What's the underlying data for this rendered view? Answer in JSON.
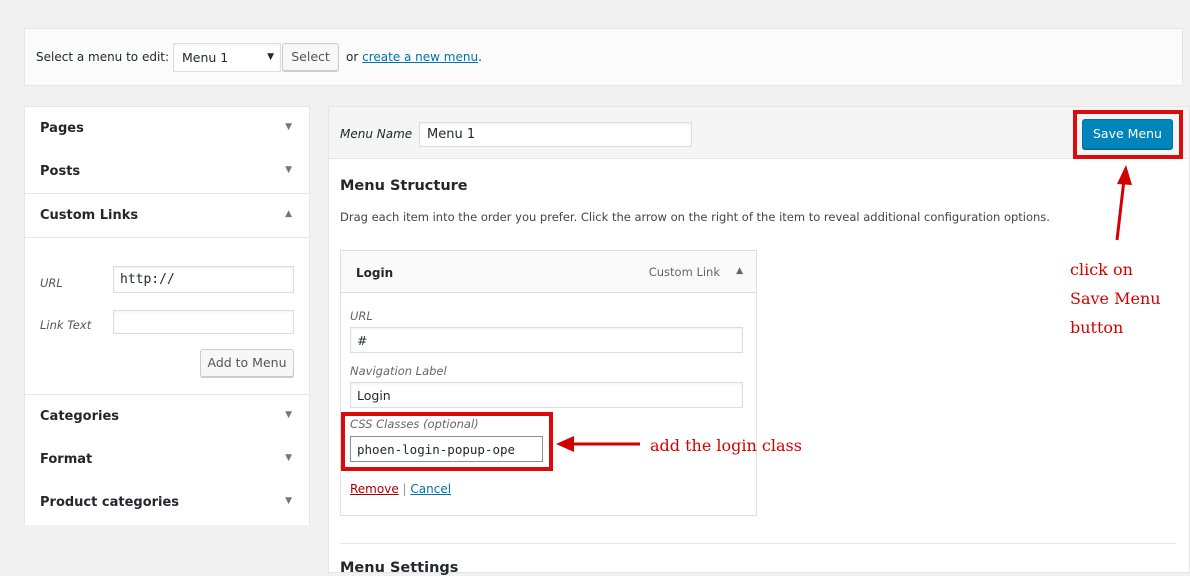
{
  "manage": {
    "label": "Select a menu to edit:",
    "selected_menu": "Menu 1",
    "select_button": "Select",
    "or_text": "or",
    "create_link": "create a new menu",
    "period": "."
  },
  "sidebar": {
    "sections": [
      {
        "title": "Pages",
        "expanded": false
      },
      {
        "title": "Posts",
        "expanded": false
      },
      {
        "title": "Custom Links",
        "expanded": true
      },
      {
        "title": "Categories",
        "expanded": false
      },
      {
        "title": "Format",
        "expanded": false
      },
      {
        "title": "Product categories",
        "expanded": false
      }
    ],
    "custom_links": {
      "url_label": "URL",
      "url_value": "http://",
      "link_text_label": "Link Text",
      "link_text_value": "",
      "add_button": "Add to Menu"
    }
  },
  "editor": {
    "menu_name_label": "Menu Name",
    "menu_name_value": "Menu 1",
    "save_button": "Save Menu",
    "structure_title": "Menu Structure",
    "structure_desc": "Drag each item into the order you prefer. Click the arrow on the right of the item to reveal additional configuration options.",
    "item": {
      "title": "Login",
      "type": "Custom Link",
      "url_label": "URL",
      "url_value": "#",
      "nav_label": "Navigation Label",
      "nav_value": "Login",
      "css_label": "CSS Classes (optional)",
      "css_value": "phoen-login-popup-ope",
      "remove": "Remove",
      "separator": "|",
      "cancel": "Cancel"
    },
    "settings_title": "Menu Settings"
  },
  "annotations": {
    "save_note": [
      "click on",
      "Save Menu",
      "button"
    ],
    "css_note": "add the login class"
  },
  "colors": {
    "primary_button": "#0085ba",
    "link": "#0073aa",
    "annotation_red": "#d40000"
  },
  "icons": {
    "collapsed": "▼",
    "expanded": "▲",
    "select_caret": "▼"
  }
}
